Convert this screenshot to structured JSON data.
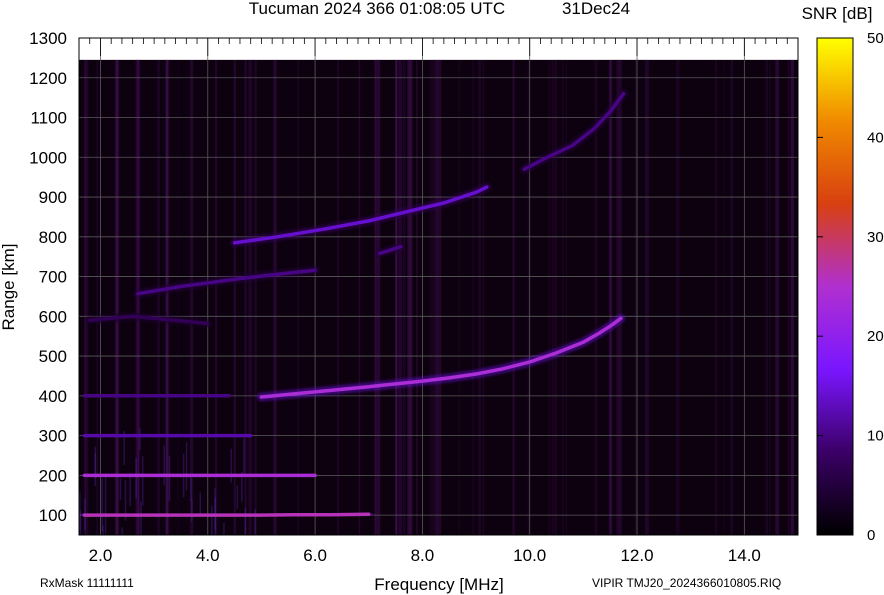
{
  "chart_data": {
    "type": "heatmap",
    "title": "Tucuman 2024 366 01:08:05 UTC",
    "title_date": "31Dec24",
    "xlabel": "Frequency [MHz]",
    "ylabel": "Range [km]",
    "xlim": [
      1.6,
      15.0
    ],
    "ylim": [
      50,
      1300
    ],
    "data_range_top": 1245,
    "x_ticks": [
      2.0,
      4.0,
      6.0,
      8.0,
      10.0,
      12.0,
      14.0
    ],
    "x_tick_labels": [
      "2.0",
      "4.0",
      "6.0",
      "8.0",
      "10.0",
      "12.0",
      "14.0"
    ],
    "y_ticks": [
      100,
      200,
      300,
      400,
      500,
      600,
      700,
      800,
      900,
      1000,
      1100,
      1200,
      1300
    ],
    "y_tick_labels": [
      "100",
      "200",
      "300",
      "400",
      "500",
      "600",
      "700",
      "800",
      "900",
      "1000",
      "1100",
      "1200",
      "1300"
    ],
    "colorbar": {
      "label": "SNR [dB]",
      "min": 0,
      "max": 50,
      "ticks": [
        0,
        10,
        20,
        30,
        40,
        50
      ],
      "tick_labels": [
        "0",
        "10",
        "20",
        "30",
        "40",
        "50"
      ],
      "colors": [
        "#000000",
        "#3a0066",
        "#7a16ff",
        "#b030d0",
        "#d84010",
        "#f08a00",
        "#ffff00"
      ]
    },
    "grid": true,
    "background_color": "#0d000f",
    "traces": [
      {
        "name": "",
        "points": [
          [
            1.7,
            100
          ],
          [
            2.5,
            100
          ],
          [
            3.5,
            100
          ],
          [
            4.5,
            100
          ],
          [
            5.0,
            100
          ],
          [
            5.6,
            101
          ],
          [
            6.3,
            101
          ],
          [
            7.0,
            102
          ]
        ],
        "snr": 26
      },
      {
        "name": "",
        "points": [
          [
            1.7,
            200
          ],
          [
            2.5,
            200
          ],
          [
            3.5,
            200
          ],
          [
            4.7,
            200
          ],
          [
            5.4,
            200
          ],
          [
            6.0,
            200
          ]
        ],
        "snr": 24
      },
      {
        "name": "",
        "points": [
          [
            1.7,
            300
          ],
          [
            2.5,
            300
          ],
          [
            3.5,
            300
          ],
          [
            4.4,
            300
          ],
          [
            4.8,
            300
          ]
        ],
        "snr": 12
      },
      {
        "name": "",
        "points": [
          [
            1.7,
            400
          ],
          [
            2.5,
            400
          ],
          [
            3.5,
            400
          ],
          [
            4.4,
            400
          ]
        ],
        "snr": 10
      },
      {
        "name": "",
        "points": [
          [
            5.0,
            397
          ],
          [
            6.0,
            410
          ],
          [
            7.0,
            423
          ],
          [
            8.0,
            437
          ],
          [
            8.5,
            445
          ],
          [
            9.0,
            455
          ],
          [
            9.5,
            468
          ],
          [
            10.0,
            485
          ],
          [
            10.5,
            508
          ],
          [
            11.0,
            535
          ],
          [
            11.3,
            558
          ],
          [
            11.55,
            580
          ],
          [
            11.7,
            595
          ]
        ],
        "snr": 24
      },
      {
        "name": "",
        "points": [
          [
            1.8,
            590
          ],
          [
            2.6,
            600
          ],
          [
            4.0,
            582
          ]
        ],
        "snr": 7
      },
      {
        "name": "",
        "points": [
          [
            2.7,
            657
          ],
          [
            3.5,
            675
          ],
          [
            4.5,
            693
          ],
          [
            5.3,
            706
          ],
          [
            6.0,
            716
          ]
        ],
        "snr": 10
      },
      {
        "name": "",
        "points": [
          [
            7.2,
            758
          ],
          [
            7.6,
            775
          ]
        ],
        "snr": 10
      },
      {
        "name": "",
        "points": [
          [
            4.5,
            785
          ],
          [
            5.3,
            800
          ],
          [
            6.2,
            820
          ],
          [
            7.0,
            840
          ],
          [
            7.8,
            866
          ],
          [
            8.4,
            885
          ],
          [
            9.0,
            912
          ],
          [
            9.2,
            925
          ]
        ],
        "snr": 14
      },
      {
        "name": "",
        "points": [
          [
            9.9,
            970
          ],
          [
            10.3,
            998
          ],
          [
            10.8,
            1030
          ],
          [
            11.2,
            1072
          ],
          [
            11.5,
            1115
          ],
          [
            11.75,
            1160
          ]
        ],
        "snr": 10
      }
    ]
  },
  "footer": {
    "left": "RxMask 11111111",
    "right": "VIPIR  TMJ20_2024366010805.RIQ"
  }
}
